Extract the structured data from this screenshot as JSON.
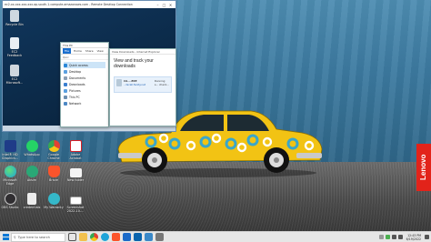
{
  "desktop_icons": [
    {
      "label": "Recycle Bin",
      "icon": "recycle-bin-icon",
      "color": "#cfd8e0"
    },
    {
      "label": "EC2 Feedback",
      "icon": "feedback-icon",
      "color": "#e8eef4"
    },
    {
      "label": "EC2 Microsoft...",
      "icon": "document-icon",
      "color": "#d0d7de"
    },
    {
      "label": "Intel® HD Graphics...",
      "icon": "intel-graphics-icon",
      "color": "#1f3c88"
    },
    {
      "label": "WhatsApp",
      "icon": "whatsapp-icon",
      "color": "#25d366"
    },
    {
      "label": "Google Chrome",
      "icon": "chrome-icon",
      "color": "#e34133"
    },
    {
      "label": "Adobe Acrobat",
      "icon": "acrobat-icon",
      "color": "#d71f26"
    },
    {
      "label": "Microsoft Edge",
      "icon": "edge-icon",
      "color": "#1fa4d8"
    },
    {
      "label": "Aksim",
      "icon": "aksim-icon",
      "color": "#2aa876"
    },
    {
      "label": "Brave",
      "icon": "brave-icon",
      "color": "#fb542b"
    },
    {
      "label": "New folder",
      "icon": "folder-icon",
      "color": "#f4f4f4"
    },
    {
      "label": "OBS Studio",
      "icon": "obs-icon",
      "color": "#302e31"
    },
    {
      "label": "credentials",
      "icon": "text-file-icon",
      "color": "#ececec"
    },
    {
      "label": "My Warranty",
      "icon": "warranty-icon",
      "color": "#35b8c9"
    },
    {
      "label": "Screenshot 2022-10-...",
      "icon": "screenshot-icon",
      "color": "#ffffff"
    }
  ],
  "remote_window": {
    "title": "ec2-xx-xxx-xxx-xxx.ap-south-1.compute.amazonaws.com - Remote Desktop Connection",
    "icons": [
      {
        "label": "Recycle Bin",
        "icon": "recycle-bin-icon"
      },
      {
        "label": "EC2 Feedback",
        "icon": "feedback-icon"
      },
      {
        "label": "EC2 Microsoft...",
        "icon": "document-icon"
      }
    ]
  },
  "explorer": {
    "title": "This PC",
    "tabs": [
      "File",
      "Home",
      "Share",
      "View"
    ],
    "address": "Quic",
    "nav": [
      {
        "label": "Quick access",
        "color": "#2b88d8"
      },
      {
        "label": "Desktop",
        "color": "#5aa0e0"
      },
      {
        "label": "Documents",
        "color": "#8a9fb4"
      },
      {
        "label": "Downloads",
        "color": "#3a7fd0"
      },
      {
        "label": "Pictures",
        "color": "#5aa0e0"
      },
      {
        "label": "This PC",
        "color": "#6c8fb0"
      },
      {
        "label": "Network",
        "color": "#4d88c4"
      }
    ]
  },
  "downloads": {
    "title": "View Downloads - Internet Explorer",
    "heading": "View and track your downloads",
    "item": {
      "name": "CA....EXE",
      "source": "...tscall.fanity.net",
      "status": "Running s... check..."
    }
  },
  "taskbar": {
    "search_placeholder": "Type here to search",
    "clock_time": "12:43 PM",
    "clock_date": "6/19/2022",
    "apps": [
      {
        "icon": "task-view-icon",
        "color": "#555555"
      },
      {
        "icon": "file-explorer-icon",
        "color": "#f2c14e"
      },
      {
        "icon": "chrome-icon",
        "color": "#e34133"
      },
      {
        "icon": "edge-icon",
        "color": "#1fa4d8"
      },
      {
        "icon": "brave-icon",
        "color": "#fb542b"
      },
      {
        "icon": "store-icon",
        "color": "#1b6ac9"
      },
      {
        "icon": "mail-icon",
        "color": "#0a64ad"
      },
      {
        "icon": "remote-desktop-icon",
        "color": "#3a88c8"
      },
      {
        "icon": "settings-icon",
        "color": "#777777"
      }
    ]
  },
  "brand": {
    "lenovo_label": "Lenovo",
    "lenovo_color": "#e2231a"
  },
  "colors": {
    "car_yellow": "#f2c314",
    "car_ring": "#3aa6c9",
    "rdp_desktop": "#0b2d4e"
  }
}
